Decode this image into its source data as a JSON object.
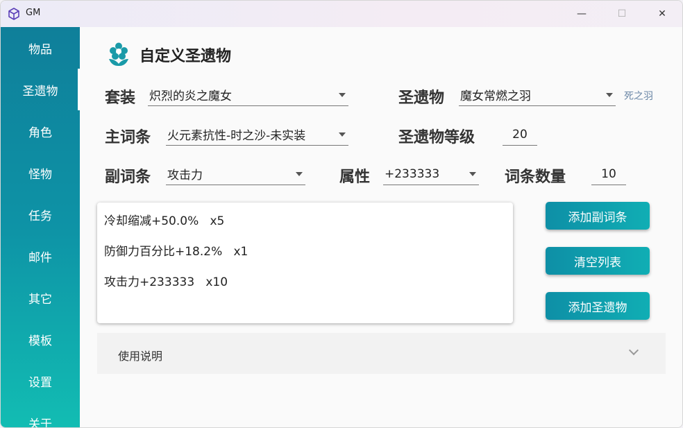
{
  "window": {
    "title": "GM",
    "minimize_glyph": "—",
    "maximize_glyph": "☐",
    "close_glyph": "✕"
  },
  "sidebar": {
    "items": [
      {
        "label": "物品"
      },
      {
        "label": "圣遗物",
        "active": true
      },
      {
        "label": "角色"
      },
      {
        "label": "怪物"
      },
      {
        "label": "任务"
      },
      {
        "label": "邮件"
      },
      {
        "label": "其它"
      },
      {
        "label": "模板"
      },
      {
        "label": "设置"
      },
      {
        "label": "关于"
      }
    ]
  },
  "page": {
    "icon": "flower-icon",
    "title": "自定义圣遗物"
  },
  "form": {
    "set": {
      "label": "套装",
      "value": "炽烈的炎之魔女"
    },
    "artifact": {
      "label": "圣遗物",
      "value": "魔女常燃之羽",
      "hint": "死之羽"
    },
    "main_stat": {
      "label": "主词条",
      "value": "火元素抗性-时之沙-未实装"
    },
    "level": {
      "label": "圣遗物等级",
      "value": "20"
    },
    "sub_stat": {
      "label": "副词条",
      "value": "攻击力"
    },
    "attribute": {
      "label": "属性",
      "value": "+233333"
    },
    "count": {
      "label": "词条数量",
      "value": "10"
    }
  },
  "sub_stat_list": [
    "冷却缩减+50.0%   x5",
    "防御力百分比+18.2%   x1",
    "攻击力+233333   x10"
  ],
  "buttons": {
    "add_sub_stat": "添加副词条",
    "clear_list": "清空列表",
    "add_artifact": "添加圣遗物"
  },
  "expander": {
    "label": "使用说明"
  },
  "colors": {
    "accent": "#0e8fa6",
    "accent_end": "#10aeb4",
    "sidebar_top": "#0f7f9a",
    "sidebar_bottom": "#12bdb3",
    "icon_teal": "#1a9aa8"
  }
}
